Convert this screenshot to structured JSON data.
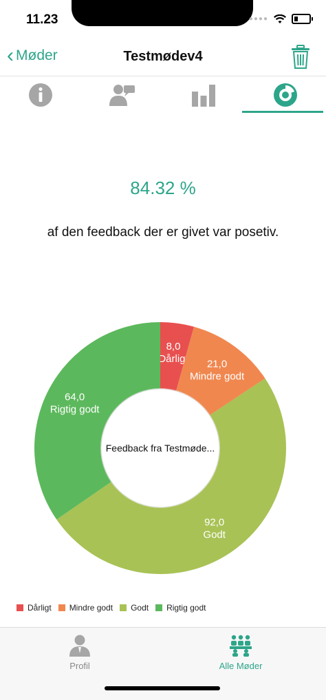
{
  "status": {
    "time": "11.23"
  },
  "nav": {
    "back_label": "Møder",
    "title": "Testmødev4"
  },
  "tabs": [
    {
      "icon": "info-icon",
      "active": false
    },
    {
      "icon": "feedback-person-icon",
      "active": false
    },
    {
      "icon": "bar-chart-icon",
      "active": false
    },
    {
      "icon": "pie-chart-icon",
      "active": true
    }
  ],
  "summary": {
    "percent": "84.32 %",
    "description": "af den feedback der er givet var posetiv."
  },
  "chart_data": {
    "type": "pie",
    "center_label": "Feedback fra Testmøde...",
    "categories": [
      "Dårligt",
      "Mindre godt",
      "Godt",
      "Rigtig godt"
    ],
    "values": [
      8.0,
      21.0,
      92.0,
      64.0
    ],
    "value_labels": [
      "8,0",
      "21,0",
      "92,0",
      "64,0"
    ],
    "colors": [
      "#e8504f",
      "#f0874f",
      "#a8c255",
      "#5cb85c"
    ],
    "legend_position": "bottom-left"
  },
  "tabbar": {
    "items": [
      {
        "label": "Profil",
        "icon": "person-icon",
        "active": false
      },
      {
        "label": "Alle Møder",
        "icon": "group-meeting-icon",
        "active": true
      }
    ]
  },
  "colors": {
    "accent": "#2da58a",
    "inactive_icon": "#a6a6a6"
  }
}
